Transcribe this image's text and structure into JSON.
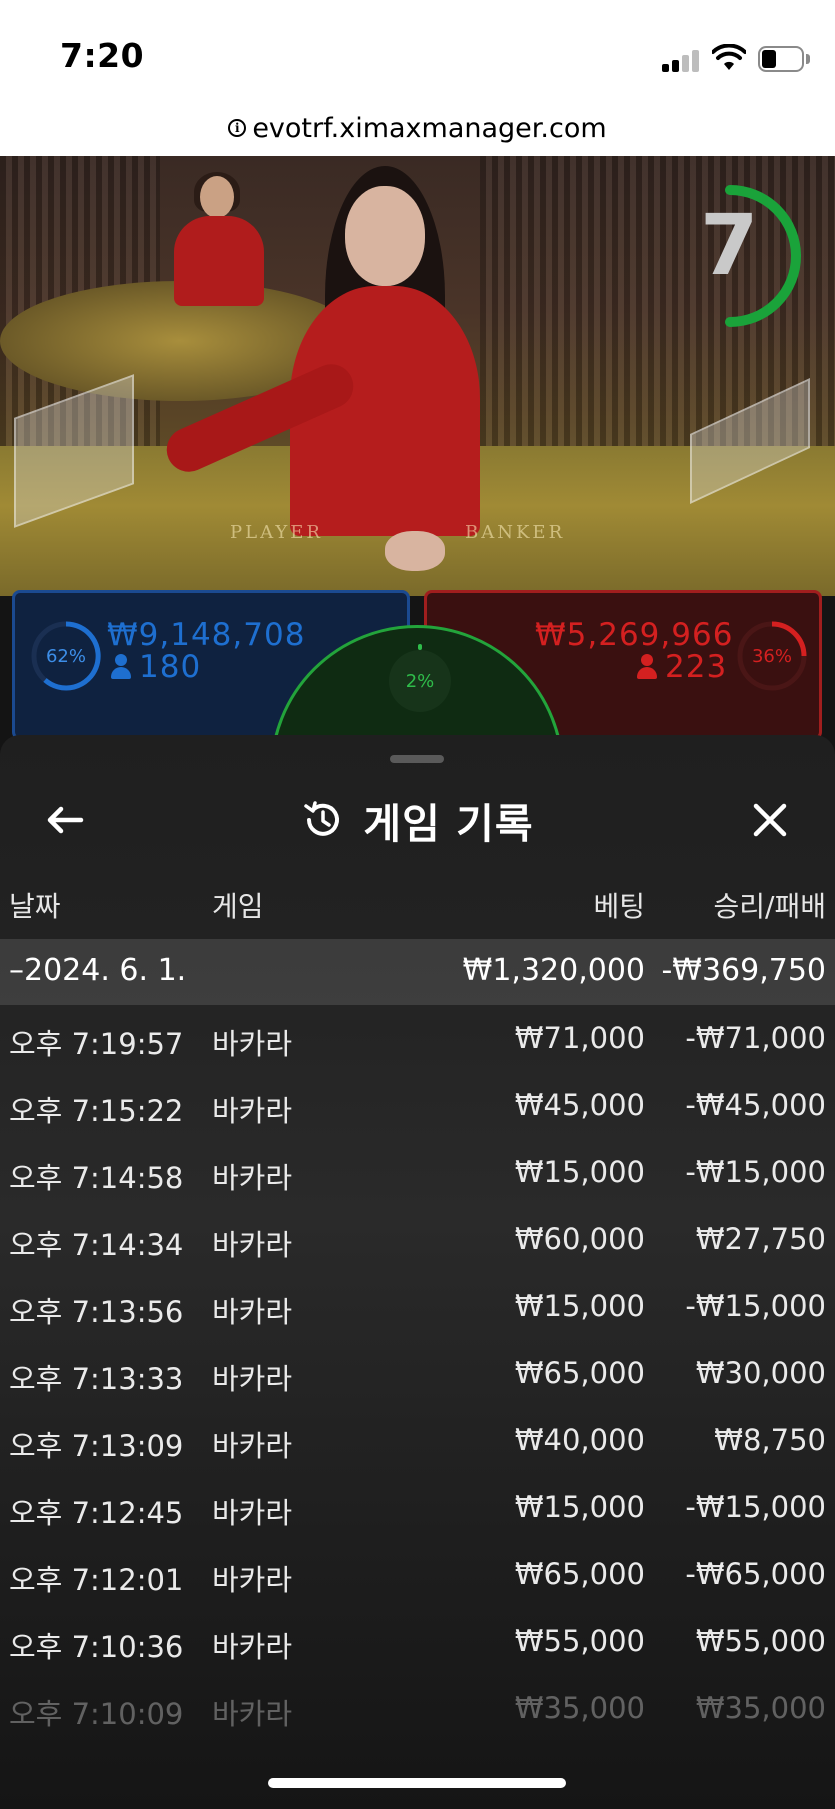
{
  "status_bar": {
    "time": "7:20"
  },
  "browser": {
    "url": "evotrf.ximaxmanager.com"
  },
  "video": {
    "timer": "7",
    "table_text_player": "PLAYER",
    "table_text_banker": "BANKER"
  },
  "bets": {
    "player": {
      "percent": "62%",
      "amount": "₩9,148,708",
      "count": "180",
      "color": "#1e6fd0"
    },
    "banker": {
      "percent": "36%",
      "amount": "₩5,269,966",
      "count": "223",
      "color": "#d42020"
    },
    "tie": {
      "percent": "2%",
      "color": "#2fbd4a"
    }
  },
  "history": {
    "title": "게임 기록",
    "columns": {
      "date": "날짜",
      "game": "게임",
      "bet": "베팅",
      "win_loss": "승리/패배"
    },
    "date_group": {
      "date": "–2024. 6. 1.",
      "bet_total": "₩1,320,000",
      "win_loss_total": "-₩369,750"
    },
    "rows": [
      {
        "time": "오후 7:19:57",
        "game": "바카라",
        "bet": "₩71,000",
        "result": "-₩71,000"
      },
      {
        "time": "오후 7:15:22",
        "game": "바카라",
        "bet": "₩45,000",
        "result": "-₩45,000"
      },
      {
        "time": "오후 7:14:58",
        "game": "바카라",
        "bet": "₩15,000",
        "result": "-₩15,000"
      },
      {
        "time": "오후 7:14:34",
        "game": "바카라",
        "bet": "₩60,000",
        "result": "₩27,750"
      },
      {
        "time": "오후 7:13:56",
        "game": "바카라",
        "bet": "₩15,000",
        "result": "-₩15,000"
      },
      {
        "time": "오후 7:13:33",
        "game": "바카라",
        "bet": "₩65,000",
        "result": "₩30,000"
      },
      {
        "time": "오후 7:13:09",
        "game": "바카라",
        "bet": "₩40,000",
        "result": "₩8,750"
      },
      {
        "time": "오후 7:12:45",
        "game": "바카라",
        "bet": "₩15,000",
        "result": "-₩15,000"
      },
      {
        "time": "오후 7:12:01",
        "game": "바카라",
        "bet": "₩65,000",
        "result": "-₩65,000"
      },
      {
        "time": "오후 7:10:36",
        "game": "바카라",
        "bet": "₩55,000",
        "result": "₩55,000"
      },
      {
        "time": "오후 7:10:09",
        "game": "바카라",
        "bet": "₩35,000",
        "result": "₩35,000"
      }
    ]
  }
}
